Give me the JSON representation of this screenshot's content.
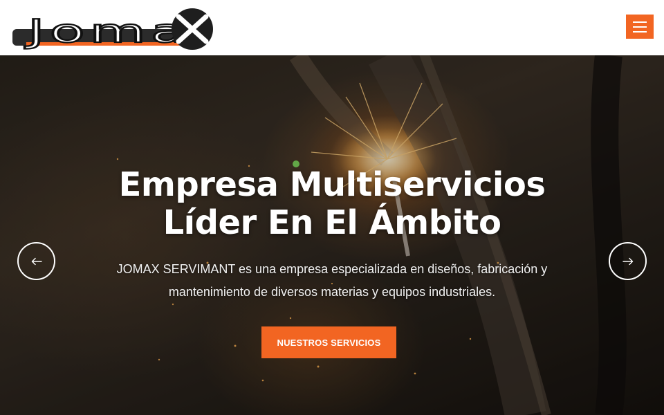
{
  "header": {
    "logo_text": "Jomax",
    "menu_icon": "hamburger-icon",
    "accent_color": "#f26522"
  },
  "hero": {
    "title_line1": "Empresa Multiservicios",
    "title_line2": "Líder En El Ámbito",
    "description_line1": "JOMAX SERVIMANT es una empresa especializada en diseños, fabricación y",
    "description_line2": "mantenimiento de diversos materias y equipos industriales.",
    "cta_label": "NUESTROS SERVICIOS",
    "prev_icon": "arrow-left-icon",
    "next_icon": "arrow-right-icon"
  }
}
